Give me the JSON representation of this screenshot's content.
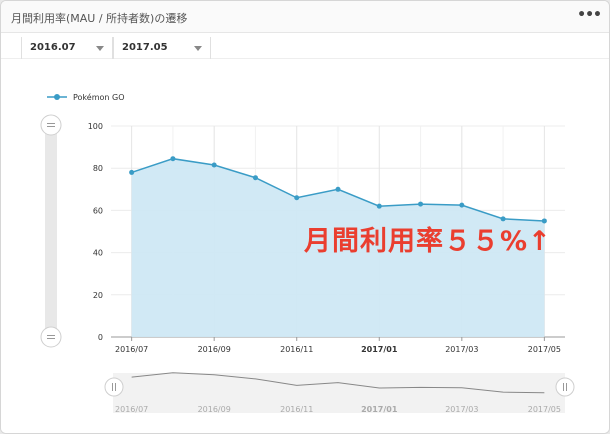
{
  "header": {
    "title": "月間利用率(MAU / 所持者数)の遷移",
    "menu_label": "•••"
  },
  "filters": {
    "start_value": "2016.07",
    "end_value": "2017.05"
  },
  "annotation": "月間利用率５５%↑",
  "colors": {
    "line": "#3a9cc6",
    "fill": "#cfe8f4",
    "annotation": "#ea3e2f",
    "navigator_line": "#888888"
  },
  "chart_data": {
    "type": "area",
    "series": [
      {
        "name": "Pokémon GO",
        "values": [
          78,
          84.5,
          81.5,
          75.5,
          66,
          70,
          62,
          63,
          62.5,
          56,
          55
        ]
      }
    ],
    "x": [
      "2016/07",
      "2016/08",
      "2016/09",
      "2016/10",
      "2016/11",
      "2016/12",
      "2017/01",
      "2017/02",
      "2017/03",
      "2017/04",
      "2017/05"
    ],
    "x_tick_labels": [
      "2016/07",
      "2016/09",
      "2016/11",
      "2017/01",
      "2017/03",
      "2017/05"
    ],
    "bold_tick": "2017/01",
    "y_ticks": [
      0,
      20,
      40,
      60,
      80,
      100
    ],
    "ylim": [
      0,
      100
    ],
    "grid": true,
    "legend_position": "top-left"
  }
}
